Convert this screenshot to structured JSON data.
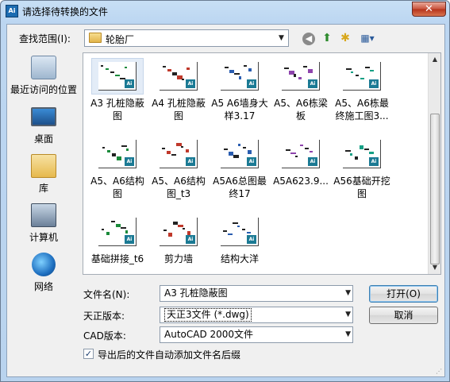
{
  "window": {
    "title": "请选择待转换的文件",
    "app_icon_text": "Ai",
    "close_glyph": "✕"
  },
  "lookin": {
    "label": "查找范围(I):",
    "value": "轮胎厂"
  },
  "toolbar": {
    "back_glyph": "◀",
    "up_glyph": "⬆",
    "newfolder_glyph": "✱",
    "views_glyph": "▦▾"
  },
  "places": [
    {
      "label": "最近访问的位置",
      "icon": "recent-places-icon"
    },
    {
      "label": "桌面",
      "icon": "desktop-icon"
    },
    {
      "label": "库",
      "icon": "library-icon"
    },
    {
      "label": "计算机",
      "icon": "computer-icon"
    },
    {
      "label": "网络",
      "icon": "network-icon"
    }
  ],
  "files": [
    {
      "name": "A3 孔桩隐蔽图",
      "selected": true
    },
    {
      "name": "A4 孔桩隐蔽图",
      "selected": false
    },
    {
      "name": "A5 A6墙身大样3.17",
      "selected": false
    },
    {
      "name": "A5、A6栋梁板",
      "selected": false
    },
    {
      "name": "A5、A6栋最终施工图3...",
      "selected": false
    },
    {
      "name": "A5、A6结构图",
      "selected": false
    },
    {
      "name": "A5、A6结构图_t3",
      "selected": false
    },
    {
      "name": "A5A6总图最终17",
      "selected": false
    },
    {
      "name": "A5A623.9...",
      "selected": false
    },
    {
      "name": "A56基础开挖图",
      "selected": false
    },
    {
      "name": "基础拼接_t6",
      "selected": false
    },
    {
      "name": "剪力墙",
      "selected": false
    },
    {
      "name": "结构大洋",
      "selected": false
    }
  ],
  "thumb_tag": "Ai",
  "filename": {
    "label": "文件名(N):",
    "value": "A3 孔桩隐蔽图"
  },
  "tangent_version": {
    "label": "天正版本:",
    "value": "天正3文件 (*.dwg)"
  },
  "cad_version": {
    "label": "CAD版本:",
    "value": "AutoCAD 2000文件"
  },
  "buttons": {
    "open": "打开(O)",
    "cancel": "取消"
  },
  "suffix_option": {
    "label": "导出后的文件自动添加文件名后缀",
    "checked": true,
    "check_glyph": "✓"
  },
  "dropdown_glyph": "▼",
  "scroll_up_glyph": "▲",
  "scroll_down_glyph": "▼",
  "colors": {
    "title_gradient_top": "#c7dff5",
    "selection": "#e3ecf7",
    "thumb_tag": "#1b7a94",
    "close_button": "#c8523c"
  }
}
